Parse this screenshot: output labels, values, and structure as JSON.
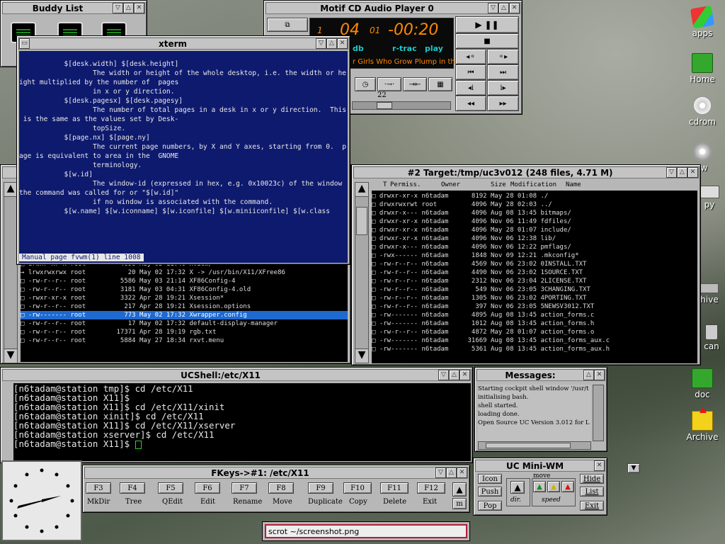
{
  "buddy_list": {
    "title": "Buddy List"
  },
  "cd_player": {
    "title": "Motif CD Audio Player 0",
    "track": "1",
    "min": "04",
    "sec_label": "01",
    "time": "-00:20",
    "db": "db",
    "rtrac": "r-trac",
    "play": "play",
    "song": "r Girls Who Grow Plump in th",
    "volume": "22"
  },
  "xterm": {
    "title": "xterm",
    "status": "Manual page fvwm(1) line 1008",
    "lines": [
      "           $[desk.width] $[desk.height]",
      "                  The width or height of the whole desktop, i.e. the width or he",
      "ight multiplied by the number of  pages",
      "                  in x or y direction.",
      "",
      "           $[desk.pagesx] $[desk.pagesy]",
      "                  The number of total pages in a desk in x or y direction.  This",
      " is the same as the values set by Desk-",
      "                  topSize.",
      "",
      "           $[page.nx] $[page.ny]",
      "                  The current page numbers, by X and Y axes, starting from 0.  p",
      "age is equivalent to area in the  GNOME",
      "                  terminology.",
      "",
      "           $[w.id]",
      "                  The window-id (expressed in hex, e.g. 0x10023c) of the window",
      "the command was called for or \"$[w.id]\"",
      "                  if no window is associated with the command.",
      "",
      "           $[w.name] $[w.iconname] $[w.iconfile] $[w.miniiconfile] $[w.class"
    ]
  },
  "left_files": {
    "rows": [
      {
        "icon": "D",
        "perm": "drwxr-xr-x",
        "owner": "root",
        "size": "4096",
        "date": "May 05 11:40",
        "name": "xview/"
      },
      {
        "icon": "→",
        "perm": "lrwxrwxrwx",
        "owner": "root",
        "size": "20",
        "date": "May 02 17:32",
        "name": "X -> /usr/bin/X11/XFree86"
      },
      {
        "icon": "D",
        "perm": "-rw-r--r--",
        "owner": "root",
        "size": "5586",
        "date": "May 03 21:14",
        "name": "XF86Config-4"
      },
      {
        "icon": "D",
        "perm": "-rw-r--r--",
        "owner": "root",
        "size": "3181",
        "date": "May 03 04:31",
        "name": "XF86Config-4.old"
      },
      {
        "icon": "D",
        "perm": "-rwxr-xr-x",
        "owner": "root",
        "size": "3322",
        "date": "Apr 28 19:21",
        "name": "Xsession*"
      },
      {
        "icon": "D",
        "perm": "-rw-r--r--",
        "owner": "root",
        "size": "217",
        "date": "Apr 28 19:21",
        "name": "Xsession.options"
      },
      {
        "icon": "D",
        "perm": "-rw-------",
        "owner": "root",
        "size": "773",
        "date": "May 02 17:32",
        "name": "Xwrapper.config",
        "selected": true
      },
      {
        "icon": "D",
        "perm": "-rw-r--r--",
        "owner": "root",
        "size": "17",
        "date": "May 02 17:32",
        "name": "default-display-manager"
      },
      {
        "icon": "D",
        "perm": "-rw-r--r--",
        "owner": "root",
        "size": "17371",
        "date": "Apr 28 19:19",
        "name": "rgb.txt"
      },
      {
        "icon": "D",
        "perm": "-rw-r--r--",
        "owner": "root",
        "size": "5884",
        "date": "May 27 18:34",
        "name": "rxvt.menu"
      }
    ]
  },
  "target": {
    "title": "#2 Target:/tmp/uc3v012 (248 files, 4.71 M)",
    "headers": {
      "t": "T",
      "perm": "Permiss.",
      "owner": "Owner",
      "size": "Size",
      "date": "Modification",
      "name": "Name"
    },
    "rows": [
      {
        "perm": "drwxr-xr-x",
        "owner": "n6tadam",
        "size": "8192",
        "date": "May 28 01:08",
        "name": "./"
      },
      {
        "perm": "drwxrwxrwt",
        "owner": "root",
        "size": "4096",
        "date": "May 28 02:03",
        "name": "../"
      },
      {
        "perm": "drwxr-x---",
        "owner": "n6tadam",
        "size": "4096",
        "date": "Aug 08 13:45",
        "name": "bitmaps/"
      },
      {
        "perm": "drwxr-xr-x",
        "owner": "n6tadam",
        "size": "4096",
        "date": "Nov 06 11:49",
        "name": "fdfiles/"
      },
      {
        "perm": "drwxr-xr-x",
        "owner": "n6tadam",
        "size": "4096",
        "date": "May 28 01:07",
        "name": "include/"
      },
      {
        "perm": "drwxr-xr-x",
        "owner": "n6tadam",
        "size": "4096",
        "date": "Nov 06 12:38",
        "name": "lib/"
      },
      {
        "perm": "drwxr-x---",
        "owner": "n6tadam",
        "size": "4096",
        "date": "Nov 06 12:22",
        "name": "pmflags/"
      },
      {
        "perm": "-rwx------",
        "owner": "n6tadam",
        "size": "1848",
        "date": "Nov 09 12:21",
        "name": ".mkconfig*"
      },
      {
        "perm": "-rw-r--r--",
        "owner": "n6tadam",
        "size": "4569",
        "date": "Nov 06 23:02",
        "name": "0INSTALL.TXT"
      },
      {
        "perm": "-rw-r--r--",
        "owner": "n6tadam",
        "size": "4490",
        "date": "Nov 06 23:02",
        "name": "1SOURCE.TXT"
      },
      {
        "perm": "-rw-r--r--",
        "owner": "n6tadam",
        "size": "2312",
        "date": "Nov 06 23:04",
        "name": "2LICENSE.TXT"
      },
      {
        "perm": "-rw-r--r--",
        "owner": "n6tadam",
        "size": "549",
        "date": "Nov 06 23:05",
        "name": "3CHANGING.TXT"
      },
      {
        "perm": "-rw-r--r--",
        "owner": "n6tadam",
        "size": "1305",
        "date": "Nov 06 23:02",
        "name": "4PORTING.TXT"
      },
      {
        "perm": "-rw-r--r--",
        "owner": "n6tadam",
        "size": "397",
        "date": "Nov 06 23:05",
        "name": "5NEWSV3012.TXT"
      },
      {
        "perm": "-rw-------",
        "owner": "n6tadam",
        "size": "4895",
        "date": "Aug 08 13:45",
        "name": "action_forms.c"
      },
      {
        "perm": "-rw-------",
        "owner": "n6tadam",
        "size": "1012",
        "date": "Aug 08 13:45",
        "name": "action_forms.h"
      },
      {
        "perm": "-rw-r--r--",
        "owner": "n6tadam",
        "size": "4872",
        "date": "May 28 01:07",
        "name": "action_forms.o"
      },
      {
        "perm": "-rw-------",
        "owner": "n6tadam",
        "size": "31669",
        "date": "Aug 08 13:45",
        "name": "action_forms_aux.c"
      },
      {
        "perm": "-rw-------",
        "owner": "n6tadam",
        "size": "5361",
        "date": "Aug 08 13:45",
        "name": "action_forms_aux.h"
      }
    ]
  },
  "ucshell": {
    "title": "UCShell:/etc/X11",
    "lines": [
      "[n6tadam@station tmp]$ cd /etc/X11",
      "[n6tadam@station X11]$",
      "[n6tadam@station X11]$ cd /etc/X11/xinit",
      "[n6tadam@station xinit]$ cd /etc/X11",
      "[n6tadam@station X11]$ cd /etc/X11/xserver",
      "[n6tadam@station xserver]$ cd /etc/X11",
      "[n6tadam@station X11]$ "
    ]
  },
  "messages": {
    "title": "Messages:",
    "lines": [
      "Starting cockpit shell window '/usr/t",
      "initialising bash.",
      "shell started.",
      "loading done.",
      "Open Source UC Version 3.012 for L"
    ]
  },
  "fkeys": {
    "title": "FKeys->#1: /etc/X11",
    "keys": [
      {
        "key": "F3",
        "label": "MkDir"
      },
      {
        "key": "F4",
        "label": "Tree"
      },
      {
        "key": "F5",
        "label": "QEdit"
      },
      {
        "key": "F6",
        "label": "Edit"
      },
      {
        "key": "F7",
        "label": "Rename"
      },
      {
        "key": "F8",
        "label": "Move"
      },
      {
        "key": "F9",
        "label": "Duplicate"
      },
      {
        "key": "F10",
        "label": "Copy"
      },
      {
        "key": "F11",
        "label": "Delete"
      },
      {
        "key": "F12",
        "label": "Exit"
      }
    ],
    "m": "m"
  },
  "miniwm": {
    "title": "UC Mini-WM",
    "icon": "Icon",
    "push": "Push",
    "pop": "Pop",
    "hide": "Hide",
    "list": "List",
    "exit": "Exit",
    "move": "move",
    "dir": "dir.",
    "speed": "speed"
  },
  "command": {
    "value": "scrot ~/screenshot.png"
  },
  "desktop": {
    "icons": [
      {
        "label": "apps"
      },
      {
        "label": "Home"
      },
      {
        "label": "cdrom"
      },
      {
        "label": "rw"
      },
      {
        "label": "py"
      },
      {
        "label": "hive"
      },
      {
        "label": "can"
      },
      {
        "label": "doc"
      },
      {
        "label": "Archive"
      }
    ]
  }
}
